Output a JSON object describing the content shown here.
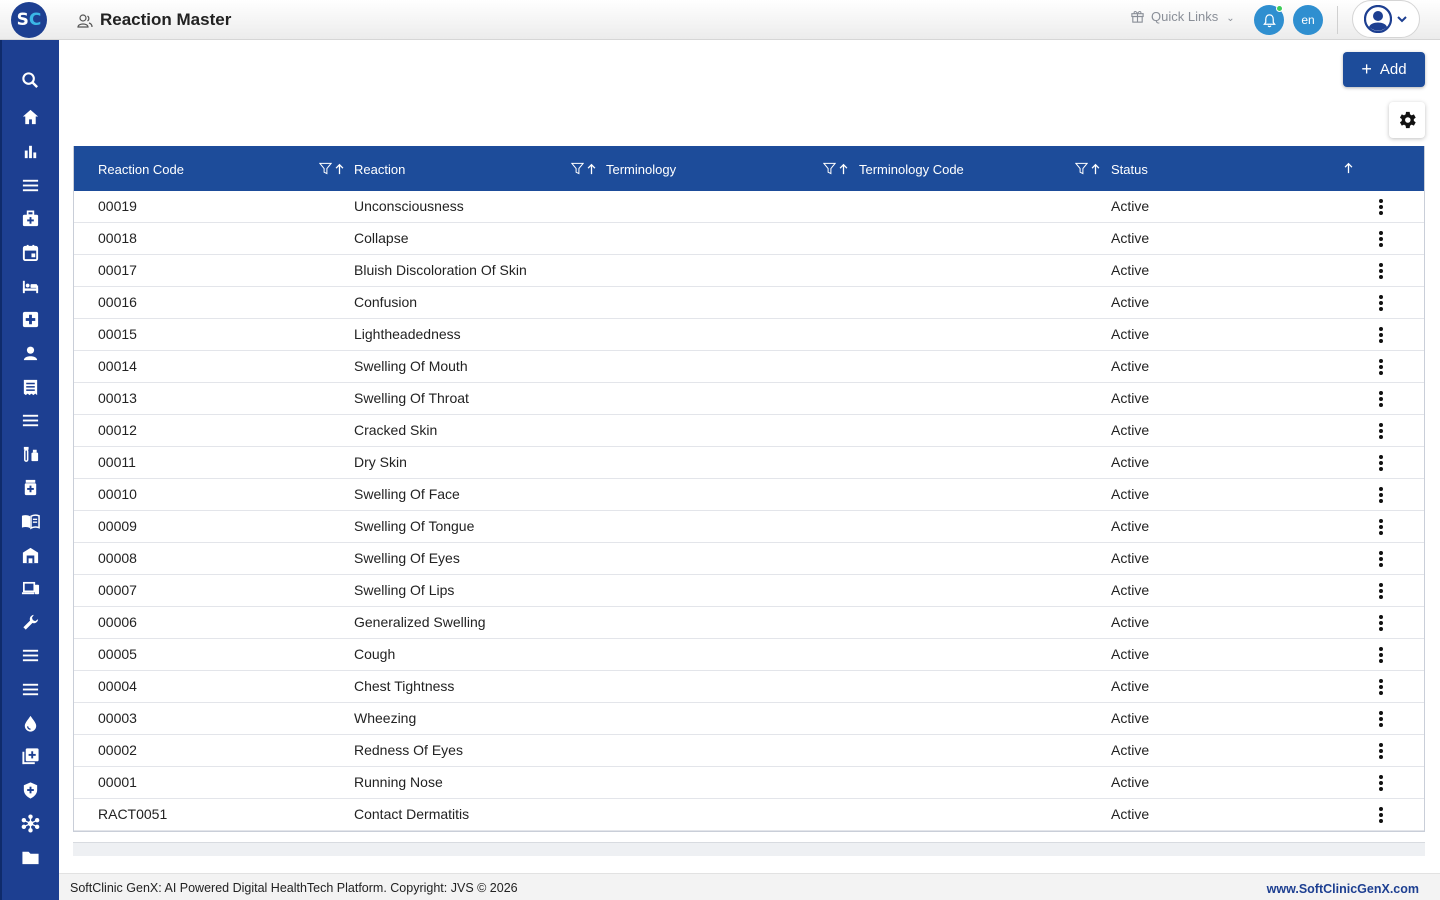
{
  "app": {
    "logo_letters": [
      "S",
      "C"
    ],
    "page_title": "Reaction Master"
  },
  "topbar": {
    "quick_links_label": "Quick Links",
    "language_label": "en",
    "icons": [
      "gift-icon",
      "bell-icon",
      "user-avatar-icon",
      "chevron-down-icon"
    ]
  },
  "sidebar": {
    "items": [
      {
        "icon": "search-icon"
      },
      {
        "icon": "home-icon"
      },
      {
        "icon": "bar-chart-icon"
      },
      {
        "icon": "menu-icon"
      },
      {
        "icon": "medical-bag-icon"
      },
      {
        "icon": "calendar-icon"
      },
      {
        "icon": "bed-icon"
      },
      {
        "icon": "medical-plus-icon"
      },
      {
        "icon": "person-icon"
      },
      {
        "icon": "receipt-icon"
      },
      {
        "icon": "menu-icon"
      },
      {
        "icon": "lab-icon"
      },
      {
        "icon": "pharmacy-icon"
      },
      {
        "icon": "book-icon"
      },
      {
        "icon": "warehouse-icon"
      },
      {
        "icon": "devices-icon"
      },
      {
        "icon": "wrench-icon"
      },
      {
        "icon": "menu-icon"
      },
      {
        "icon": "menu-icon"
      },
      {
        "icon": "blood-drop-icon"
      },
      {
        "icon": "add-box-icon"
      },
      {
        "icon": "shield-icon"
      },
      {
        "icon": "hub-icon"
      },
      {
        "icon": "folder-icon"
      }
    ]
  },
  "toolbar": {
    "add_label": "Add"
  },
  "grid": {
    "columns": [
      "Reaction Code",
      "Reaction",
      "Terminology",
      "Terminology Code",
      "Status"
    ],
    "rows": [
      {
        "code": "00019",
        "reaction": "Unconsciousness",
        "terminology": "",
        "terminology_code": "",
        "status": "Active"
      },
      {
        "code": "00018",
        "reaction": "Collapse",
        "terminology": "",
        "terminology_code": "",
        "status": "Active"
      },
      {
        "code": "00017",
        "reaction": "Bluish Discoloration Of Skin",
        "terminology": "",
        "terminology_code": "",
        "status": "Active"
      },
      {
        "code": "00016",
        "reaction": "Confusion",
        "terminology": "",
        "terminology_code": "",
        "status": "Active"
      },
      {
        "code": "00015",
        "reaction": "Lightheadedness",
        "terminology": "",
        "terminology_code": "",
        "status": "Active"
      },
      {
        "code": "00014",
        "reaction": "Swelling Of Mouth",
        "terminology": "",
        "terminology_code": "",
        "status": "Active"
      },
      {
        "code": "00013",
        "reaction": "Swelling Of Throat",
        "terminology": "",
        "terminology_code": "",
        "status": "Active"
      },
      {
        "code": "00012",
        "reaction": "Cracked Skin",
        "terminology": "",
        "terminology_code": "",
        "status": "Active"
      },
      {
        "code": "00011",
        "reaction": "Dry Skin",
        "terminology": "",
        "terminology_code": "",
        "status": "Active"
      },
      {
        "code": "00010",
        "reaction": "Swelling Of Face",
        "terminology": "",
        "terminology_code": "",
        "status": "Active"
      },
      {
        "code": "00009",
        "reaction": "Swelling Of Tongue",
        "terminology": "",
        "terminology_code": "",
        "status": "Active"
      },
      {
        "code": "00008",
        "reaction": "Swelling Of Eyes",
        "terminology": "",
        "terminology_code": "",
        "status": "Active"
      },
      {
        "code": "00007",
        "reaction": "Swelling Of Lips",
        "terminology": "",
        "terminology_code": "",
        "status": "Active"
      },
      {
        "code": "00006",
        "reaction": "Generalized Swelling",
        "terminology": "",
        "terminology_code": "",
        "status": "Active"
      },
      {
        "code": "00005",
        "reaction": "Cough",
        "terminology": "",
        "terminology_code": "",
        "status": "Active"
      },
      {
        "code": "00004",
        "reaction": "Chest Tightness",
        "terminology": "",
        "terminology_code": "",
        "status": "Active"
      },
      {
        "code": "00003",
        "reaction": "Wheezing",
        "terminology": "",
        "terminology_code": "",
        "status": "Active"
      },
      {
        "code": "00002",
        "reaction": "Redness Of Eyes",
        "terminology": "",
        "terminology_code": "",
        "status": "Active"
      },
      {
        "code": "00001",
        "reaction": "Running Nose",
        "terminology": "",
        "terminology_code": "",
        "status": "Active"
      },
      {
        "code": "RACT0051",
        "reaction": "Contact Dermatitis",
        "terminology": "",
        "terminology_code": "",
        "status": "Active"
      }
    ]
  },
  "footer": {
    "copyright": "SoftClinic GenX: AI Powered Digital HealthTech Platform. Copyright: JVS © 2026",
    "website": "www.SoftClinicGenX.com"
  },
  "colors": {
    "primary": "#1d4c9a",
    "sidebar": "#1d3f91",
    "accent": "#2f8fd0",
    "online": "#3dcc59"
  }
}
